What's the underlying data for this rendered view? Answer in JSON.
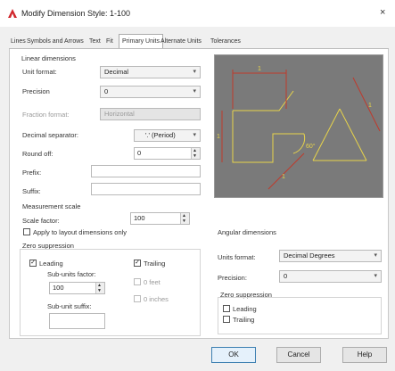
{
  "window": {
    "title": "Modify Dimension Style: 1-100",
    "close_glyph": "×"
  },
  "tabs": [
    "Lines",
    "Symbols and Arrows",
    "Text",
    "Fit",
    "Primary Units",
    "Alternate Units",
    "Tolerances"
  ],
  "active_tab": "Primary Units",
  "linear": {
    "group_label": "Linear dimensions",
    "unit_format_label": "Unit format:",
    "unit_format_value": "Decimal",
    "precision_label": "Precision",
    "precision_value": "0",
    "fraction_format_label": "Fraction format:",
    "fraction_format_value": "Horizontal",
    "decimal_sep_label": "Decimal separator:",
    "decimal_sep_value": "'.' (Period)",
    "round_off_label": "Round off:",
    "round_off_value": "0",
    "prefix_label": "Prefix:",
    "prefix_value": "",
    "suffix_label": "Suffix:",
    "suffix_value": ""
  },
  "measurement": {
    "group_label": "Measurement scale",
    "scale_label": "Scale factor:",
    "scale_value": "100",
    "apply_layout_label": "Apply to layout dimensions only"
  },
  "zero_sup_linear": {
    "group_label": "Zero suppression",
    "leading_label": "Leading",
    "trailing_label": "Trailing",
    "sub_factor_label": "Sub-units factor:",
    "sub_factor_value": "100",
    "sub_suffix_label": "Sub-unit suffix:",
    "sub_suffix_value": "",
    "feet_label": "0 feet",
    "inches_label": "0 inches",
    "leading_checked": true,
    "trailing_checked": true
  },
  "angular": {
    "group_label": "Angular dimensions",
    "units_format_label": "Units format:",
    "units_format_value": "Decimal Degrees",
    "precision_label": "Precision:",
    "precision_value": "0",
    "zero_group_label": "Zero suppression",
    "leading_label": "Leading",
    "trailing_label": "Trailing"
  },
  "preview_labels": {
    "dim_top": "1",
    "dim_left": "1",
    "dim_right": "1",
    "dim_bottom_left": "1",
    "angle": "60°"
  },
  "buttons": {
    "ok": "OK",
    "cancel": "Cancel",
    "help": "Help"
  },
  "colors": {
    "preview_bg": "#7a7a7a",
    "preview_line": "#e8d44a",
    "preview_dim": "#c0392b"
  }
}
